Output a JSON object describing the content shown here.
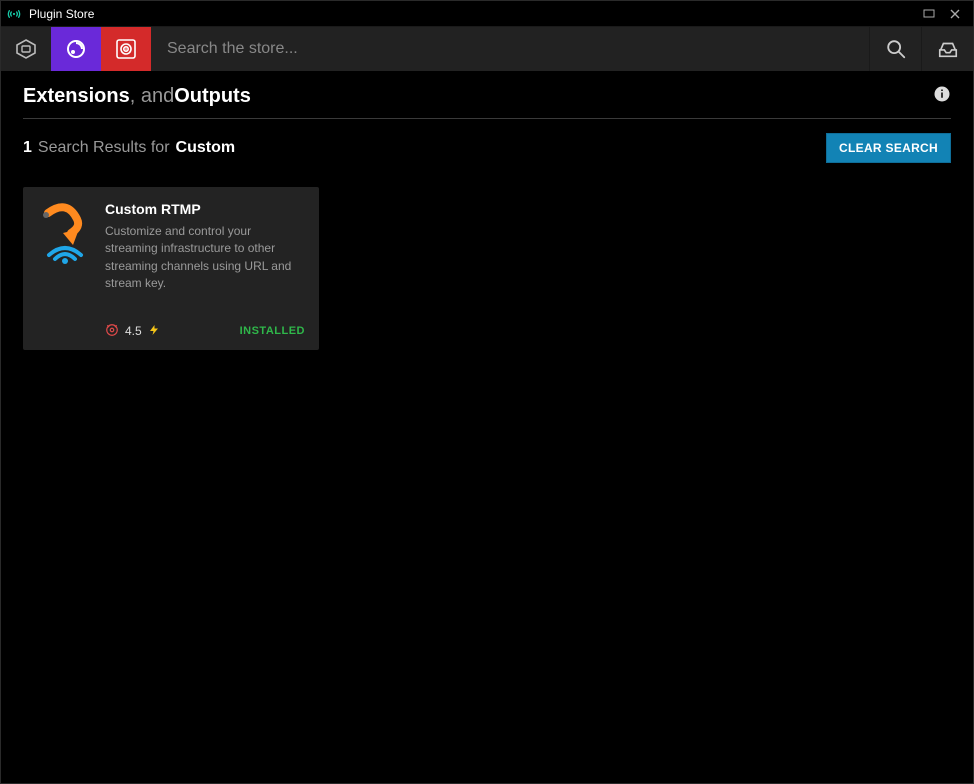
{
  "window": {
    "title": "Plugin Store"
  },
  "toolbar": {
    "search_placeholder": "Search the store..."
  },
  "page": {
    "head_strong1": "Extensions",
    "head_mid": ", and ",
    "head_strong2": "Outputs"
  },
  "results": {
    "count": "1",
    "label": "Search Results for",
    "term": "Custom",
    "clear_label": "CLEAR SEARCH"
  },
  "cards": [
    {
      "title": "Custom RTMP",
      "desc": "Customize and control your streaming infrastructure to other streaming channels using URL and stream key.",
      "rating": "4.5",
      "status": "INSTALLED"
    }
  ]
}
